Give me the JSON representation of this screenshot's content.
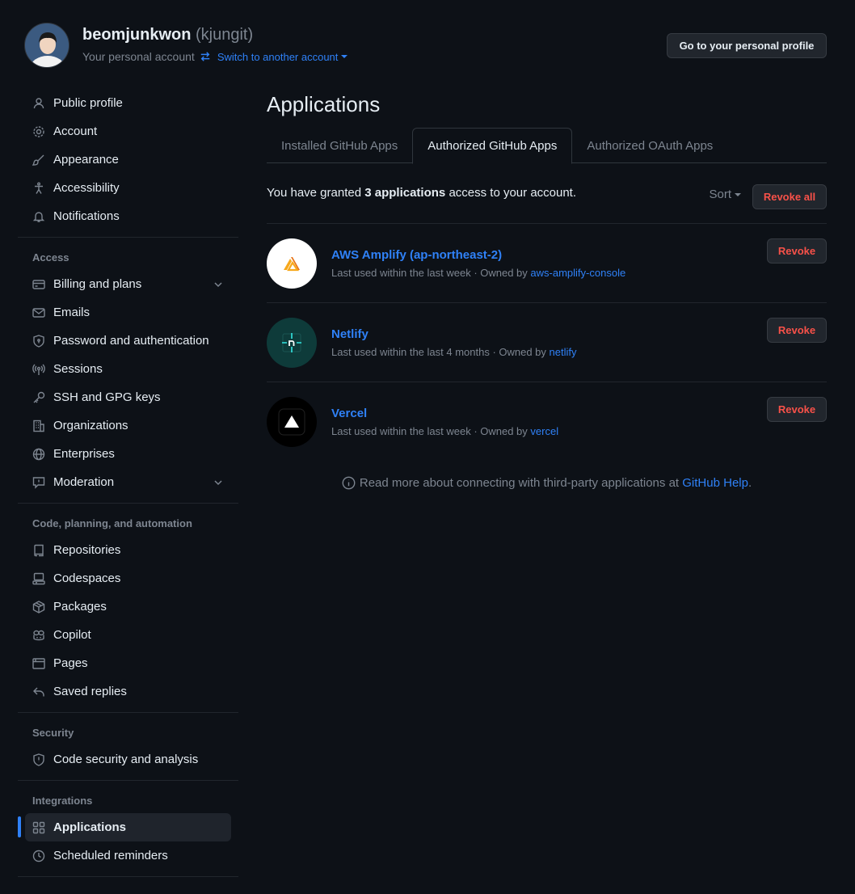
{
  "header": {
    "username": "beomjunkwon",
    "login": "(kjungit)",
    "account_type": "Your personal account",
    "switch_label": "Switch to another account",
    "profile_button": "Go to your personal profile"
  },
  "sidebar": {
    "top_items": [
      {
        "label": "Public profile",
        "icon": "person-icon"
      },
      {
        "label": "Account",
        "icon": "gear-icon"
      },
      {
        "label": "Appearance",
        "icon": "paintbrush-icon"
      },
      {
        "label": "Accessibility",
        "icon": "accessibility-icon"
      },
      {
        "label": "Notifications",
        "icon": "bell-icon"
      }
    ],
    "access_heading": "Access",
    "access_items": [
      {
        "label": "Billing and plans",
        "icon": "credit-card-icon",
        "expandable": true
      },
      {
        "label": "Emails",
        "icon": "mail-icon"
      },
      {
        "label": "Password and authentication",
        "icon": "shield-lock-icon"
      },
      {
        "label": "Sessions",
        "icon": "broadcast-icon"
      },
      {
        "label": "SSH and GPG keys",
        "icon": "key-icon"
      },
      {
        "label": "Organizations",
        "icon": "organization-icon"
      },
      {
        "label": "Enterprises",
        "icon": "globe-icon"
      },
      {
        "label": "Moderation",
        "icon": "report-icon",
        "expandable": true
      }
    ],
    "code_heading": "Code, planning, and automation",
    "code_items": [
      {
        "label": "Repositories",
        "icon": "repo-icon"
      },
      {
        "label": "Codespaces",
        "icon": "codespaces-icon"
      },
      {
        "label": "Packages",
        "icon": "package-icon"
      },
      {
        "label": "Copilot",
        "icon": "copilot-icon"
      },
      {
        "label": "Pages",
        "icon": "browser-icon"
      },
      {
        "label": "Saved replies",
        "icon": "reply-icon"
      }
    ],
    "security_heading": "Security",
    "security_items": [
      {
        "label": "Code security and analysis",
        "icon": "shield-icon"
      }
    ],
    "integrations_heading": "Integrations",
    "integrations_items": [
      {
        "label": "Applications",
        "icon": "apps-icon",
        "active": true
      },
      {
        "label": "Scheduled reminders",
        "icon": "clock-icon"
      }
    ]
  },
  "main": {
    "title": "Applications",
    "tabs": [
      {
        "label": "Installed GitHub Apps"
      },
      {
        "label": "Authorized GitHub Apps",
        "active": true
      },
      {
        "label": "Authorized OAuth Apps"
      }
    ],
    "summary": {
      "prefix": "You have granted",
      "count": "3 applications",
      "suffix": "access to your account."
    },
    "sort_label": "Sort",
    "revoke_all_label": "Revoke all",
    "apps": [
      {
        "name": "AWS Amplify (ap-northeast-2)",
        "meta": "Last used within the last week · Owned by",
        "owner": "aws-amplify-console",
        "revoke": "Revoke"
      },
      {
        "name": "Netlify",
        "meta": "Last used within the last 4 months · Owned by",
        "owner": "netlify",
        "revoke": "Revoke"
      },
      {
        "name": "Vercel",
        "meta": "Last used within the last week · Owned by",
        "owner": "vercel",
        "revoke": "Revoke"
      }
    ],
    "help": {
      "text": "Read more about connecting with third-party applications at",
      "link": "GitHub Help",
      "period": "."
    }
  },
  "colors": {
    "background": "#0d1117",
    "accent": "#2f81f7",
    "danger": "#f85149",
    "muted": "#7d8590"
  }
}
